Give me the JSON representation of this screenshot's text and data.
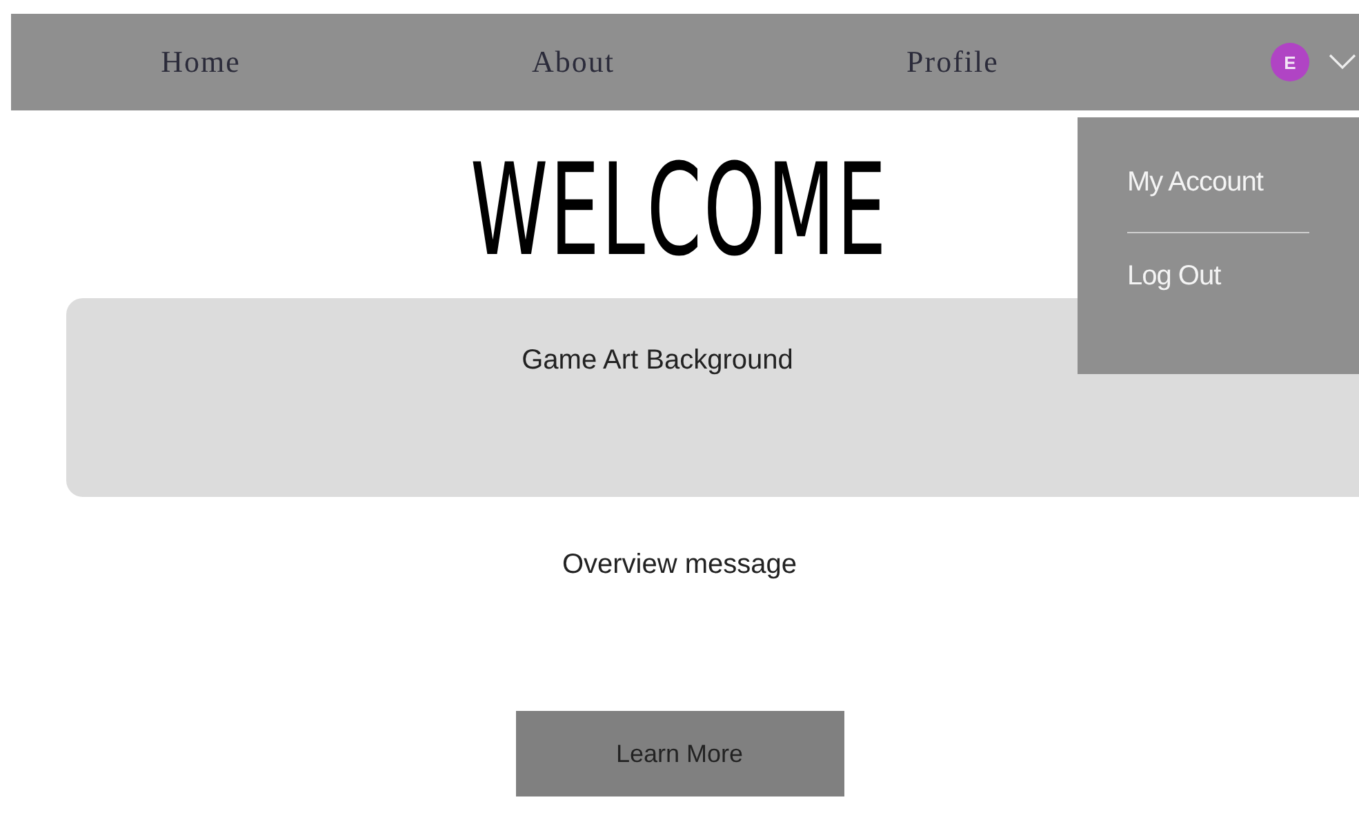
{
  "nav": {
    "links": [
      {
        "label": "Home"
      },
      {
        "label": "About"
      },
      {
        "label": "Profile"
      }
    ],
    "avatar": {
      "initial": "E",
      "color": "#b044c4"
    },
    "menu": {
      "expanded": true,
      "items": [
        {
          "label": "My Account"
        },
        {
          "label": "Log Out"
        }
      ]
    }
  },
  "heading": "WELCOME",
  "banner": {
    "label": "Game Art Background"
  },
  "overview": "Overview message",
  "button": "Learn More"
}
